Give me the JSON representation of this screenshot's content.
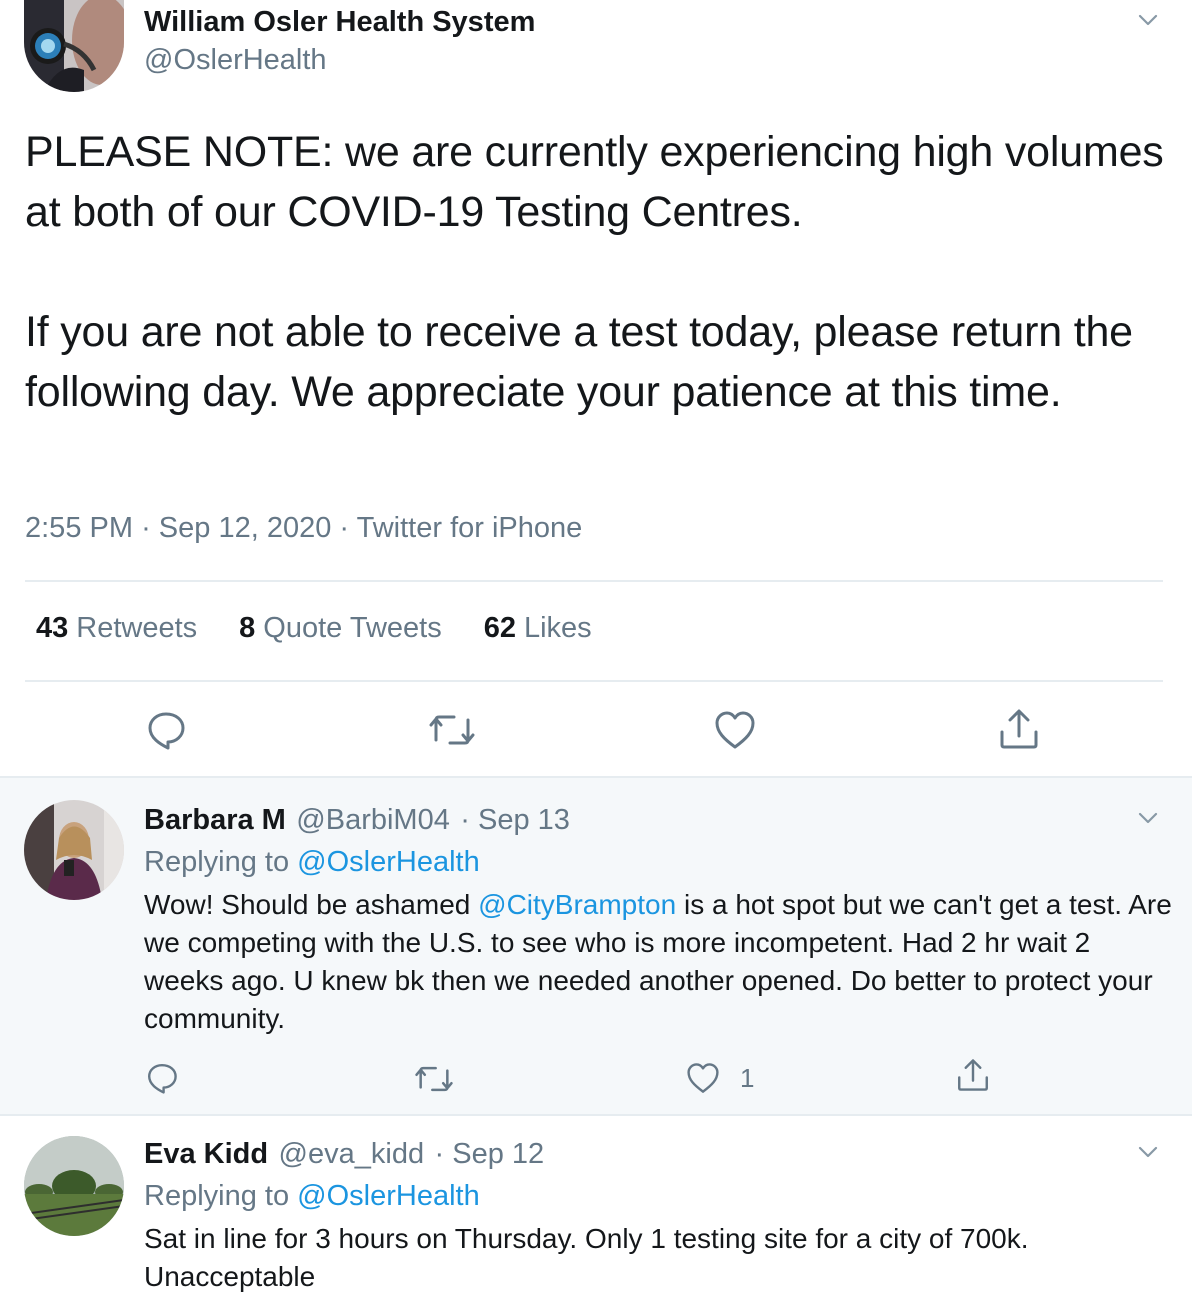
{
  "tweet": {
    "author_name": "William Osler Health System",
    "author_handle": "@OslerHealth",
    "text": "PLEASE NOTE: we are currently experiencing high volumes at both of our COVID-19 Testing Centres.\n\nIf you are not able to receive a test today, please return the following day. We appreciate your patience at this time.",
    "time": "2:55 PM",
    "date": "Sep 12, 2020",
    "source": "Twitter for iPhone",
    "separator": "·",
    "stats": {
      "retweets_count": "43",
      "retweets_label": "Retweets",
      "quotes_count": "8",
      "quotes_label": "Quote Tweets",
      "likes_count": "62",
      "likes_label": "Likes"
    }
  },
  "replies": [
    {
      "name": "Barbara M",
      "handle": "@BarbiM04",
      "date": "· Sep 13",
      "replying_prefix": "Replying to",
      "replying_to": "@OslerHealth",
      "text_before": "Wow! Should be ashamed ",
      "mention": "@CityBrampton",
      "text_after": " is a hot spot but we can't get a test. Are we competing with the U.S. to see who is more incompetent. Had 2 hr wait 2 weeks ago. U knew bk then we needed another opened. Do better to protect your community.",
      "like_count": "1"
    },
    {
      "name": "Eva Kidd",
      "handle": "@eva_kidd",
      "date": "· Sep 12",
      "replying_prefix": "Replying to",
      "replying_to": "@OslerHealth",
      "text": "Sat in line for 3 hours on Thursday. Only 1 testing site for a city of 700k. Unacceptable"
    }
  ],
  "icons": {
    "reply": "reply-icon",
    "retweet": "retweet-icon",
    "like": "heart-icon",
    "share": "share-icon",
    "more": "chevron-down-icon"
  },
  "colors": {
    "link": "#1b95e0",
    "muted": "#657786",
    "reply_bg": "#f5f8fa",
    "divider": "#e6ecf0"
  }
}
